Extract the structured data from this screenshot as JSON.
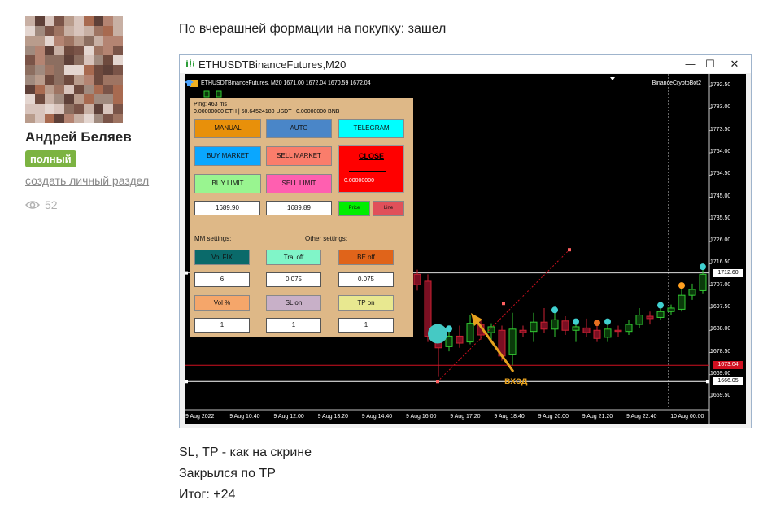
{
  "author": {
    "name": "Андрей Беляев",
    "badge": "полный",
    "create_link": "создать личный раздел",
    "views": "52"
  },
  "post": {
    "heading": "По вчерашней формации на покупку: зашел",
    "lines": [
      "SL, TP - как на скрине",
      "Закрылся по TP",
      "Итог: +24"
    ]
  },
  "window": {
    "title": "ETHUSDTBinanceFutures,M20",
    "controls": {
      "minimize": "—",
      "maximize": "☐",
      "close": "✕"
    }
  },
  "chart": {
    "header": "ETHUSDTBinanceFutures, M20  1671.00 1672.04 1670.59 1672.04",
    "bot_name": "BinanceCryptoBot2",
    "annotation": "вход",
    "colors": {
      "background": "#000000",
      "bull": "#33cc33",
      "bear": "#cc2233",
      "text": "#ffffff",
      "panel": "#deb887"
    }
  },
  "panel": {
    "ping": "Ping: 463 ms",
    "balance": "0.00000000 ETH | 50.64524180 USDT | 0.00000000 BNB",
    "buttons": {
      "manual": "MANUAL",
      "auto": "AUTO",
      "telegram": "TELEGRAM",
      "buy_market": "BUY MARKET",
      "sell_market": "SELL MARKET",
      "buy_limit": "BUY LIMIT",
      "sell_limit": "SELL LIMIT",
      "close": "CLOSE",
      "close_value": "0.00000000",
      "price": "Price",
      "line": "Line",
      "vol_fix": "Vol FIX",
      "tral_off": "Tral off",
      "be_off": "BE off",
      "vol_pct": "Vol %",
      "sl_on": "SL on",
      "tp_on": "TP on"
    },
    "fields": {
      "buy_price": "1689.90",
      "sell_price": "1689.89",
      "vol_fix_value": "6",
      "tral_value": "0.075",
      "be_value": "0.075",
      "vol_pct_value": "1",
      "sl_value": "1",
      "tp_value": "1"
    },
    "mm_settings": "MM settings:",
    "other_settings": "Other settings:"
  },
  "chart_data": {
    "type": "candlestick",
    "y_ticks": [
      "1792.50",
      "1783.00",
      "1773.50",
      "1764.00",
      "1754.50",
      "1745.00",
      "1735.50",
      "1726.00",
      "1716.50",
      "1707.00",
      "1697.50",
      "1688.00",
      "1678.50",
      "1669.00",
      "1659.50"
    ],
    "x_ticks": [
      "9 Aug 2022",
      "9 Aug 10:40",
      "9 Aug 12:00",
      "9 Aug 13:20",
      "9 Aug 14:40",
      "9 Aug 16:00",
      "9 Aug 17:20",
      "9 Aug 18:40",
      "9 Aug 20:00",
      "9 Aug 21:20",
      "9 Aug 22:40",
      "10 Aug 00:00"
    ],
    "ylim": [
      1655.0,
      1795.0
    ],
    "current_price": "1712.60",
    "sl_price": "1666.05",
    "red_line_price": "1673.04",
    "candles": [
      {
        "o": 1712.0,
        "c": 1707.5,
        "h": 1714.0,
        "l": 1705.0
      },
      {
        "o": 1709.0,
        "c": 1685.5,
        "h": 1712.0,
        "l": 1683.0
      },
      {
        "o": 1686.0,
        "c": 1680.5,
        "h": 1688.0,
        "l": 1668.0
      },
      {
        "o": 1681.0,
        "c": 1685.5,
        "h": 1688.0,
        "l": 1679.0
      },
      {
        "o": 1685.5,
        "c": 1682.5,
        "h": 1690.0,
        "l": 1680.5
      },
      {
        "o": 1683.0,
        "c": 1691.0,
        "h": 1694.5,
        "l": 1682.0
      },
      {
        "o": 1690.5,
        "c": 1686.0,
        "h": 1693.0,
        "l": 1684.0
      },
      {
        "o": 1687.0,
        "c": 1689.5,
        "h": 1691.0,
        "l": 1683.0
      },
      {
        "o": 1688.0,
        "c": 1677.0,
        "h": 1690.0,
        "l": 1675.0
      },
      {
        "o": 1677.5,
        "c": 1688.5,
        "h": 1695.5,
        "l": 1673.0
      },
      {
        "o": 1688.0,
        "c": 1687.0,
        "h": 1690.0,
        "l": 1685.0
      },
      {
        "o": 1687.5,
        "c": 1691.5,
        "h": 1695.5,
        "l": 1683.0
      },
      {
        "o": 1691.5,
        "c": 1688.5,
        "h": 1697.5,
        "l": 1687.0
      },
      {
        "o": 1688.5,
        "c": 1692.5,
        "h": 1696.0,
        "l": 1685.0
      },
      {
        "o": 1692.0,
        "c": 1688.0,
        "h": 1694.0,
        "l": 1686.0
      },
      {
        "o": 1688.0,
        "c": 1689.5,
        "h": 1691.0,
        "l": 1683.0
      },
      {
        "o": 1689.0,
        "c": 1687.0,
        "h": 1693.0,
        "l": 1685.0
      },
      {
        "o": 1688.0,
        "c": 1684.5,
        "h": 1690.5,
        "l": 1683.0
      },
      {
        "o": 1685.0,
        "c": 1688.5,
        "h": 1691.0,
        "l": 1683.0
      },
      {
        "o": 1688.0,
        "c": 1687.5,
        "h": 1690.0,
        "l": 1685.0
      },
      {
        "o": 1687.5,
        "c": 1690.5,
        "h": 1692.5,
        "l": 1686.0
      },
      {
        "o": 1690.5,
        "c": 1694.5,
        "h": 1697.5,
        "l": 1689.0
      },
      {
        "o": 1694.0,
        "c": 1693.0,
        "h": 1696.0,
        "l": 1690.5
      },
      {
        "o": 1693.5,
        "c": 1696.0,
        "h": 1698.0,
        "l": 1692.5
      },
      {
        "o": 1696.0,
        "c": 1697.5,
        "h": 1699.0,
        "l": 1694.5
      },
      {
        "o": 1697.0,
        "c": 1703.0,
        "h": 1706.5,
        "l": 1696.0
      },
      {
        "o": 1703.0,
        "c": 1705.5,
        "h": 1708.0,
        "l": 1701.0
      },
      {
        "o": 1705.0,
        "c": 1712.0,
        "h": 1714.5,
        "l": 1703.5
      }
    ]
  }
}
